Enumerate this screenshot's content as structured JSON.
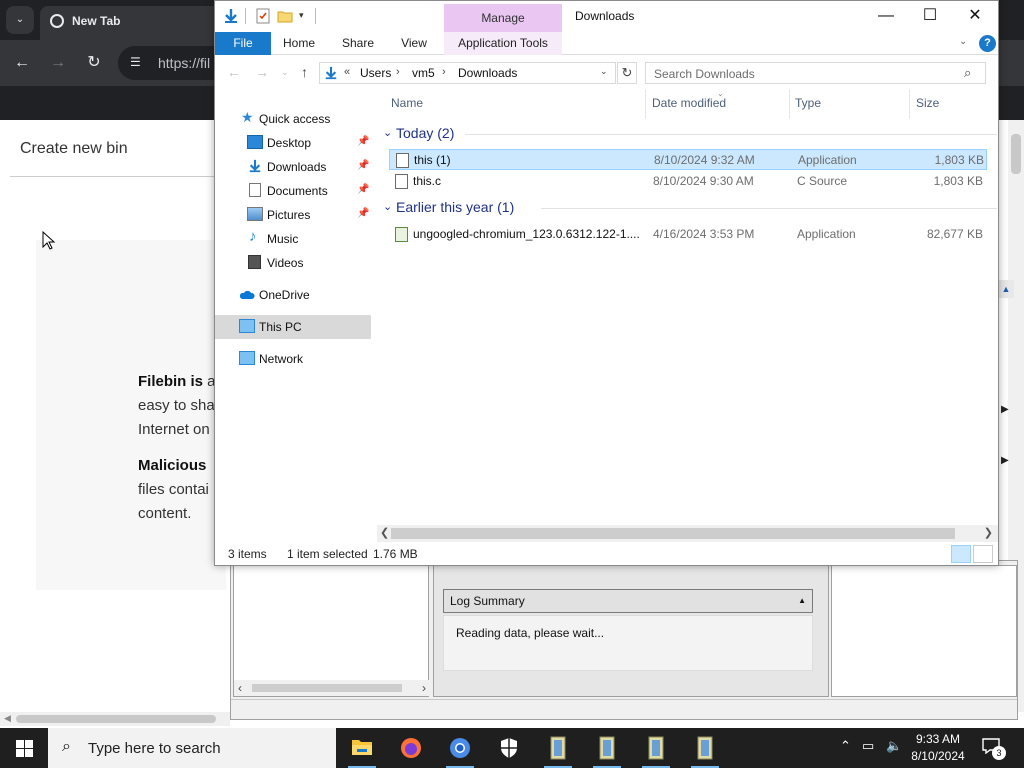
{
  "browser": {
    "tab_title": "New Tab",
    "url_text": "https://fil",
    "page": {
      "create_bin": "Create new bin",
      "filebin_bold": "Filebin is",
      "filebin_rest": " a",
      "line2": "easy to sha",
      "line3": "Internet on",
      "malicious_bold": "Malicious",
      "line5": "files contai",
      "line6": "content."
    }
  },
  "log_window": {
    "summary_label": "Log Summary",
    "summary_text": "Reading data, please wait..."
  },
  "explorer": {
    "manage_tab": "Manage",
    "window_title": "Downloads",
    "ribbon_tabs": [
      "File",
      "Home",
      "Share",
      "View",
      "Application Tools"
    ],
    "breadcrumb": [
      "«",
      "Users",
      "vm5",
      "Downloads"
    ],
    "search_placeholder": "Search Downloads",
    "nav": {
      "quick_access": "Quick access",
      "desktop": "Desktop",
      "downloads": "Downloads",
      "documents": "Documents",
      "pictures": "Pictures",
      "music": "Music",
      "videos": "Videos",
      "onedrive": "OneDrive",
      "this_pc": "This PC",
      "network": "Network"
    },
    "columns": [
      "Name",
      "Date modified",
      "Type",
      "Size"
    ],
    "groups": [
      {
        "title": "Today (2)",
        "files": [
          {
            "name": "this (1)",
            "date": "8/10/2024 9:32 AM",
            "type": "Application",
            "size": "1,803 KB"
          },
          {
            "name": "this.c",
            "date": "8/10/2024 9:30 AM",
            "type": "C Source",
            "size": "1,803 KB"
          }
        ]
      },
      {
        "title": "Earlier this year (1)",
        "files": [
          {
            "name": "ungoogled-chromium_123.0.6312.122-1....",
            "date": "4/16/2024 3:53 PM",
            "type": "Application",
            "size": "82,677 KB"
          }
        ]
      }
    ],
    "status": {
      "items": "3 items",
      "selected": "1 item selected",
      "size": "1.76 MB"
    }
  },
  "taskbar": {
    "search_text": "Type here to search",
    "time": "9:33 AM",
    "date": "8/10/2024",
    "notification_count": "3"
  },
  "colors": {
    "accent": "#1979ca",
    "selection": "#cce8ff",
    "manage_tab": "#e9c7f2",
    "group_header": "#1e3287"
  }
}
